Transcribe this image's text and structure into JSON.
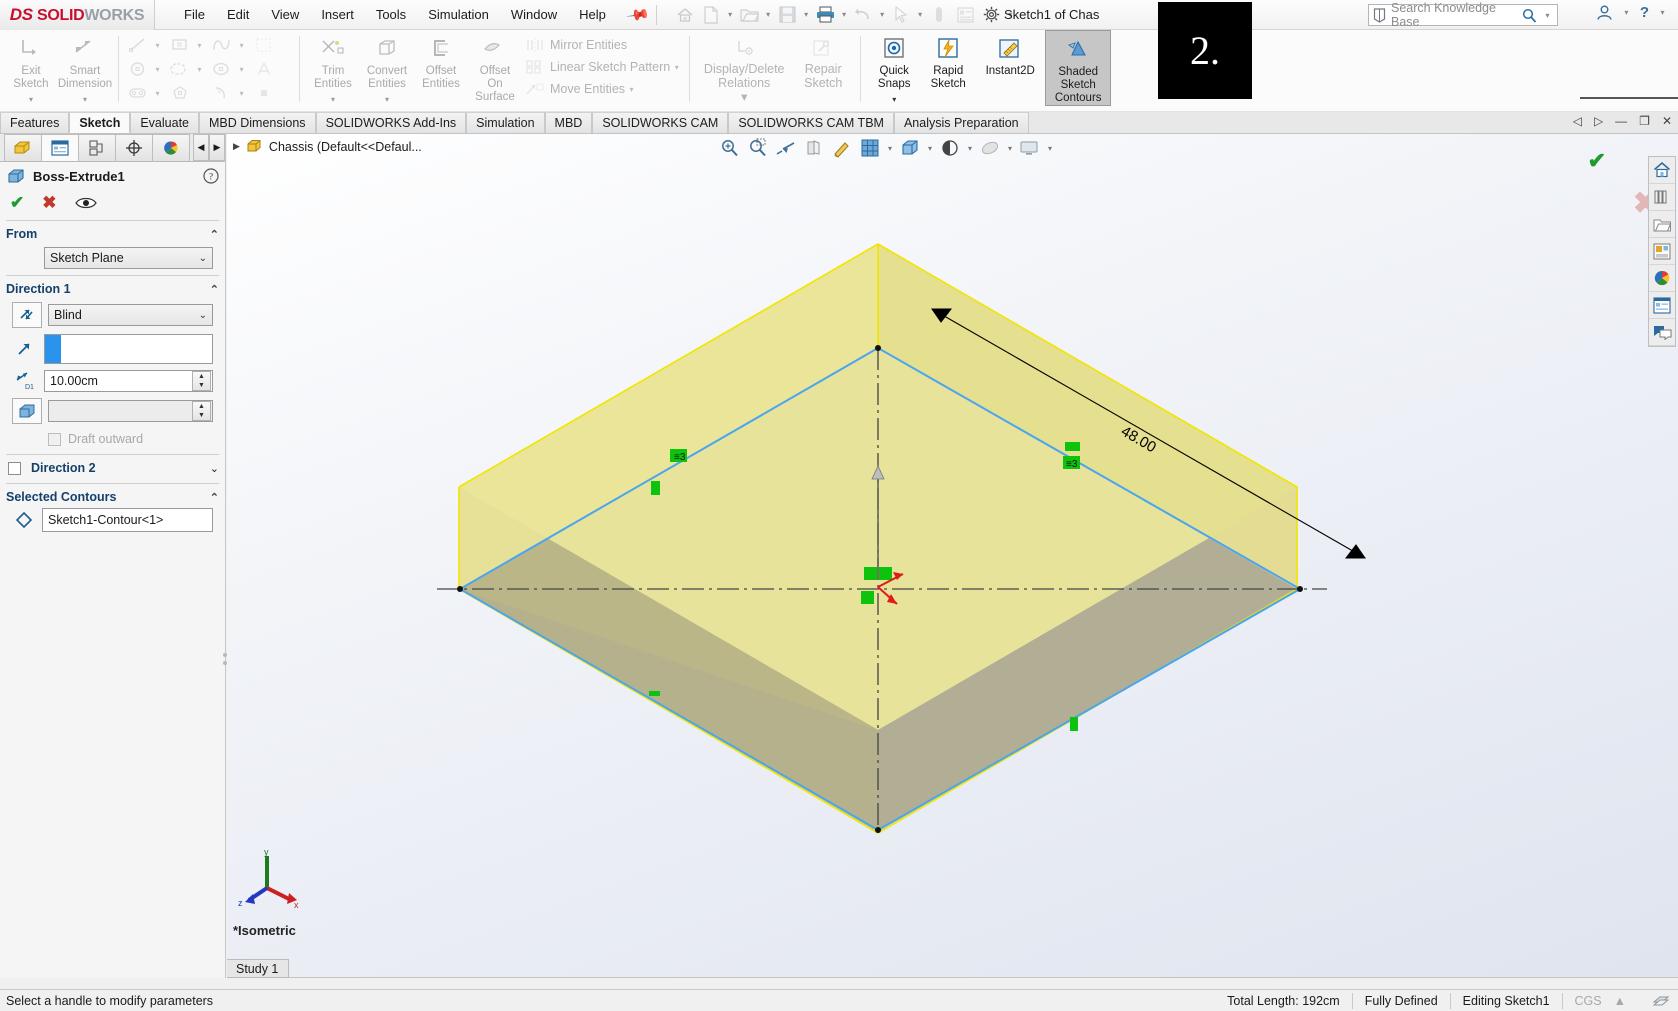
{
  "app": {
    "brand_ds": "DS",
    "brand_solid": "SOLID",
    "brand_works": "WORKS",
    "document_title": "Sketch1 of Chas",
    "badge_number": "2."
  },
  "menubar": {
    "items": [
      {
        "label": "File"
      },
      {
        "label": "Edit"
      },
      {
        "label": "View"
      },
      {
        "label": "Insert"
      },
      {
        "label": "Tools"
      },
      {
        "label": "Simulation"
      },
      {
        "label": "Window"
      },
      {
        "label": "Help"
      }
    ],
    "pin_icon": "pin-icon"
  },
  "quickbar": {
    "buttons": [
      {
        "name": "home-icon",
        "label": "Home"
      },
      {
        "name": "new-document-icon",
        "label": "New"
      },
      {
        "name": "open-folder-icon",
        "label": "Open"
      },
      {
        "name": "save-icon",
        "label": "Save"
      },
      {
        "name": "print-icon",
        "label": "Print"
      },
      {
        "name": "undo-icon",
        "label": "Undo"
      },
      {
        "name": "select-cursor-icon",
        "label": "Select"
      },
      {
        "name": "rebuild-icon",
        "label": "Rebuild"
      },
      {
        "name": "options-list-icon",
        "label": "File Properties"
      },
      {
        "name": "gear-icon",
        "label": "Options"
      }
    ]
  },
  "search": {
    "placeholder": "Search Knowledge Base",
    "icon": "knowledge-base-icon",
    "magnifier": "search-icon",
    "dropdown": "chevron-down-icon"
  },
  "help_group": {
    "account_icon": "user-account-icon",
    "help_icon": "help-question-icon",
    "dropdown": "chevron-down-icon"
  },
  "ribbon": {
    "groups": [
      {
        "buttons": [
          {
            "label_top": "Exit",
            "label_bottom": "Sketch",
            "icon": "exit-sketch-icon",
            "enabled": false,
            "dropdown": true
          },
          {
            "label_top": "Smart",
            "label_bottom": "Dimension",
            "icon": "smart-dimension-icon",
            "enabled": false,
            "dropdown": true
          }
        ]
      },
      {
        "sketch_entity_rows": [
          [
            {
              "icon": "line-icon"
            },
            {
              "icon": "rectangle-icon"
            },
            {
              "icon": "polygon-icon"
            }
          ],
          [
            {
              "icon": "circle-icon"
            },
            {
              "icon": "slot-icon"
            },
            {
              "icon": "arc-icon"
            }
          ],
          [
            {
              "icon": "spline-icon"
            },
            {
              "icon": "ellipse-icon"
            },
            {
              "icon": "parabola-icon"
            }
          ],
          [
            {
              "icon": "sketch-fillet-icon"
            },
            {
              "icon": "text-icon"
            },
            {
              "icon": "point-icon"
            }
          ]
        ]
      },
      {
        "buttons": [
          {
            "label_top": "Trim",
            "label_bottom": "Entities",
            "icon": "trim-entities-icon",
            "enabled": false,
            "dropdown": true
          },
          {
            "label_top": "Convert",
            "label_bottom": "Entities",
            "icon": "convert-entities-icon",
            "enabled": false,
            "dropdown": true
          },
          {
            "label_top": "Offset",
            "label_bottom": "Entities",
            "icon": "offset-entities-icon",
            "enabled": false,
            "dropdown": false
          },
          {
            "label_top": "Offset",
            "label_mid": "On",
            "label_bottom": "Surface",
            "icon": "offset-on-surface-icon",
            "enabled": false,
            "dropdown": false
          }
        ]
      },
      {
        "mini_items": [
          {
            "label": "Mirror Entities",
            "icon": "mirror-entities-icon",
            "dropdown": false
          },
          {
            "label": "Linear Sketch Pattern",
            "icon": "linear-sketch-pattern-icon",
            "dropdown": true
          },
          {
            "label": "Move Entities",
            "icon": "move-entities-icon",
            "dropdown": true
          }
        ]
      },
      {
        "wide_buttons": [
          {
            "label": "Display/Delete Relations",
            "icon": "display-delete-relations-icon",
            "dropdown": true
          },
          {
            "label": "Repair Sketch",
            "icon": "repair-sketch-icon",
            "dropdown": false
          }
        ]
      },
      {
        "buttons": [
          {
            "label_top": "Quick",
            "label_bottom": "Snaps",
            "icon": "quick-snaps-icon",
            "enabled": true,
            "dropdown": true
          },
          {
            "label_top": "Rapid",
            "label_bottom": "Sketch",
            "icon": "rapid-sketch-icon",
            "enabled": true,
            "dropdown": false
          },
          {
            "label_top": "Instant2D",
            "label_bottom": "",
            "icon": "instant2d-icon",
            "enabled": true,
            "dropdown": false
          },
          {
            "label_top": "Shaded",
            "label_mid": "Sketch",
            "label_bottom": "Contours",
            "icon": "shaded-sketch-contours-icon",
            "enabled": true,
            "selected": true,
            "dropdown": false
          }
        ]
      }
    ]
  },
  "command_tabs": {
    "items": [
      {
        "label": "Features",
        "active": false
      },
      {
        "label": "Sketch",
        "active": true
      },
      {
        "label": "Evaluate",
        "active": false
      },
      {
        "label": "MBD Dimensions",
        "active": false
      },
      {
        "label": "SOLIDWORKS Add-Ins",
        "active": false
      },
      {
        "label": "Simulation",
        "active": false
      },
      {
        "label": "MBD",
        "active": false
      },
      {
        "label": "SOLIDWORKS CAM",
        "active": false
      },
      {
        "label": "SOLIDWORKS CAM TBM",
        "active": false
      },
      {
        "label": "Analysis Preparation",
        "active": false
      }
    ],
    "window_controls": [
      {
        "name": "collapse-left-icon",
        "glyph": "◁"
      },
      {
        "name": "expand-right-icon",
        "glyph": "▷"
      },
      {
        "name": "minimize-window-button",
        "glyph": "—"
      },
      {
        "name": "restore-window-button",
        "glyph": "❐"
      },
      {
        "name": "close-window-button",
        "glyph": "✕"
      }
    ]
  },
  "left_panel": {
    "tabs": [
      {
        "name": "feature-manager-tab",
        "icon": "feature-tree-icon",
        "active": false
      },
      {
        "name": "property-manager-tab",
        "icon": "property-list-icon",
        "active": true
      },
      {
        "name": "configuration-manager-tab",
        "icon": "configuration-icon",
        "active": false
      },
      {
        "name": "dimxpert-manager-tab",
        "icon": "dimxpert-icon",
        "active": false
      },
      {
        "name": "display-manager-tab",
        "icon": "display-sphere-icon",
        "active": false
      }
    ],
    "property_manager": {
      "title": "Boss-Extrude1",
      "title_icon": "boss-extrude-icon",
      "help_icon": "help-question-icon",
      "actions": [
        {
          "name": "ok-button",
          "glyph": "✔",
          "color": "#1f9c2c"
        },
        {
          "name": "cancel-button",
          "glyph": "✖",
          "color": "#c0392b"
        },
        {
          "name": "preview-eye-button",
          "glyph": "eye-icon",
          "color": "#333333"
        }
      ],
      "sections": [
        {
          "name": "from-section",
          "title": "From",
          "collapsed": false,
          "start_condition": "Sketch Plane"
        },
        {
          "name": "direction1-section",
          "title": "Direction 1",
          "collapsed": false,
          "reverse_icon": "reverse-direction-icon",
          "end_condition": "Blind",
          "direction_vector_icon": "direction-vector-icon",
          "direction_vector_value": "",
          "depth_icon": "depth-d1-icon",
          "depth_value": "10.00cm",
          "draft_icon": "draft-angle-icon",
          "draft_value": "",
          "draft_outward_label": "Draft outward",
          "draft_outward_checked": false
        },
        {
          "name": "direction2-section",
          "title": "Direction 2",
          "collapsed": true,
          "checked": false
        },
        {
          "name": "selected-contours-section",
          "title": "Selected Contours",
          "collapsed": false,
          "contour_icon": "contour-diamond-icon",
          "contour_value": "Sketch1-Contour<1>"
        }
      ]
    }
  },
  "graphics": {
    "breadcrumb": {
      "expand_glyph": "▶",
      "icon": "part-document-icon",
      "label": "Chassis  (Default<<Defaul..."
    },
    "view_toolbar": [
      {
        "name": "zoom-to-fit-icon",
        "dropdown": false
      },
      {
        "name": "zoom-to-area-icon",
        "dropdown": false
      },
      {
        "name": "previous-view-icon",
        "dropdown": false
      },
      {
        "name": "section-view-icon",
        "dropdown": false
      },
      {
        "name": "view-orientation-paint-icon",
        "dropdown": false
      },
      {
        "name": "view-orientation-icon",
        "dropdown": true
      },
      {
        "name": "display-style-icon",
        "dropdown": true
      },
      {
        "name": "hide-show-items-icon",
        "dropdown": true
      },
      {
        "name": "apply-scene-icon",
        "dropdown": true
      },
      {
        "name": "view-settings-icon",
        "dropdown": true
      }
    ],
    "confirm_corner": {
      "ok_glyph": "✔",
      "cancel_glyph": "✖"
    },
    "right_dock": [
      {
        "name": "home-task-icon"
      },
      {
        "name": "design-library-icon"
      },
      {
        "name": "file-explorer-icon"
      },
      {
        "name": "view-palette-icon"
      },
      {
        "name": "appearances-scenes-icon"
      },
      {
        "name": "custom-properties-icon"
      },
      {
        "name": "solidworks-forum-icon"
      }
    ],
    "view_label": "*Isometric",
    "study_tab": "Study 1",
    "triad": {
      "x_label": "x",
      "y_label": "y",
      "z_label": "z"
    },
    "dimension_label": "48.00",
    "relation_markers": [
      {
        "name": "equal-relation-3",
        "label": "3"
      },
      {
        "name": "equal-relation-3b",
        "label": "3"
      },
      {
        "name": "vertical-relation",
        "label": ""
      },
      {
        "name": "horizontal-relation",
        "label": ""
      },
      {
        "name": "coincident-relations",
        "label": ""
      }
    ],
    "colors": {
      "sketch_contour_fill": "#ece7a0",
      "sketch_contour_edge": "#f2e500",
      "model_face_top": "#a7a7a7",
      "model_face_bottom": "#8a8a96",
      "selected_edge": "#49a5f0",
      "relation_green": "#0ec30e",
      "dimension_black": "#000000"
    }
  },
  "status_bar": {
    "message": "Select a handle to modify parameters",
    "cells": [
      {
        "name": "total-length-status",
        "label": "Total Length: 192cm",
        "dim": false
      },
      {
        "name": "definition-status",
        "label": "Fully Defined",
        "dim": false
      },
      {
        "name": "editing-status",
        "label": "Editing Sketch1",
        "dim": false
      },
      {
        "name": "units-status",
        "label": "CGS",
        "dim": true
      },
      {
        "name": "units-dropdown",
        "label": "▲",
        "dim": true
      }
    ],
    "overlay_icon": "overlay-sketch-icon"
  }
}
